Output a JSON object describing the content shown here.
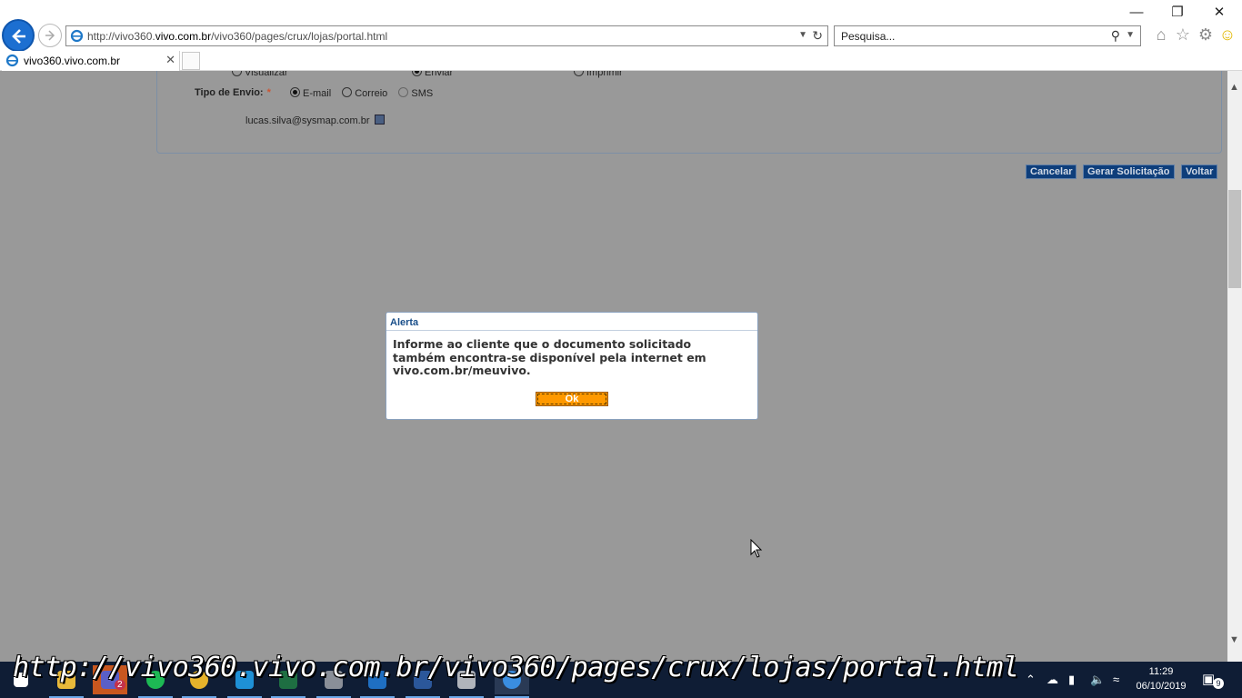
{
  "browser": {
    "url_prefix": "http://vivo360.",
    "url_domain": "vivo.com.br",
    "url_suffix": "/vivo360/pages/crux/lojas/portal.html",
    "search_placeholder": "Pesquisa...",
    "tab_title": "vivo360.vivo.com.br",
    "icons": [
      "back-icon",
      "forward-icon",
      "refresh-icon",
      "search-icon",
      "home-icon",
      "star-icon",
      "gear-icon",
      "smiley-icon"
    ]
  },
  "form": {
    "top_options": [
      "Visualizar",
      "Enviar",
      "Imprimir"
    ],
    "tipo_envio_label": "Tipo de Envio:",
    "required_mark": "*",
    "envio_options": [
      "E-mail",
      "Correio",
      "SMS"
    ],
    "envio_selected": "E-mail",
    "email": "lucas.silva@sysmap.com.br"
  },
  "actions": {
    "cancelar": "Cancelar",
    "gerar": "Gerar Solicitação",
    "voltar": "Voltar"
  },
  "alert": {
    "title": "Alerta",
    "message": "Informe ao cliente que o documento solicitado também encontra-se disponível pela internet em vivo.com.br/meuvivo.",
    "ok_label": "Ok"
  },
  "status_bar_url": "http://vivo360.vivo.com.br/vivo360/pages/crux/lojas/portal.html",
  "taskbar": {
    "time": "11:29",
    "date": "06/10/2019",
    "notification_count": "9",
    "teams_badge": "2"
  },
  "colors": {
    "page_bg": "#999999",
    "button_blue": "#0e3e7b",
    "ok_orange": "#ff9900",
    "taskbar": "#0f1d35"
  }
}
